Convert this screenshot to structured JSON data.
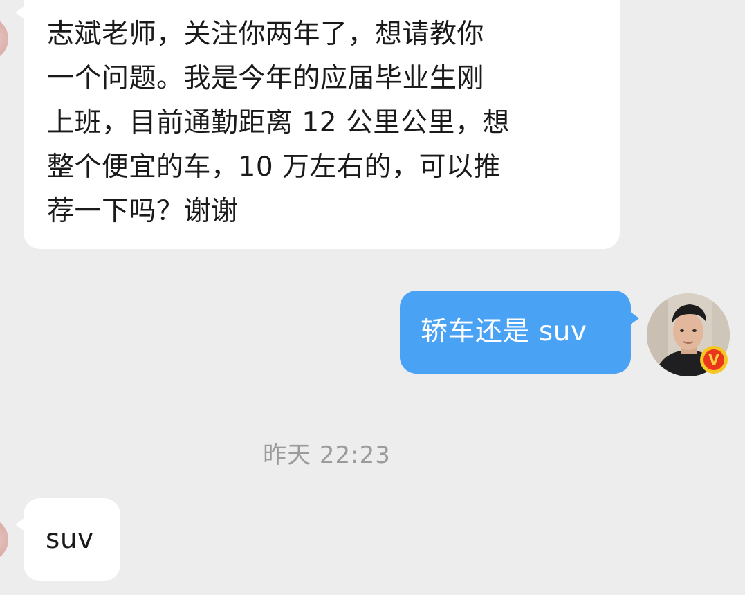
{
  "conversation": {
    "messages": [
      {
        "direction": "incoming",
        "lines": [
          "志斌老师，关注你两年了，想请教你",
          "一个问题。我是今年的应届毕业生刚",
          "上班，目前通勤距离 12 公里公里，想",
          "整个便宜的车，10 万左右的，可以推",
          "荐一下吗？谢谢"
        ]
      },
      {
        "direction": "outgoing",
        "text": "轿车还是 suv"
      },
      {
        "direction": "incoming",
        "text": "suv"
      }
    ],
    "timestamp": "昨天 22:23",
    "verified_badge_letter": "V"
  },
  "colors": {
    "background": "#ededed",
    "incoming_bubble": "#ffffff",
    "outgoing_bubble": "#4aa2f5",
    "timestamp_text": "#9b9b9b",
    "badge_outer": "#f6c623",
    "badge_inner": "#e8371d"
  },
  "icons": {
    "verified_badge": "verified-v-icon"
  }
}
